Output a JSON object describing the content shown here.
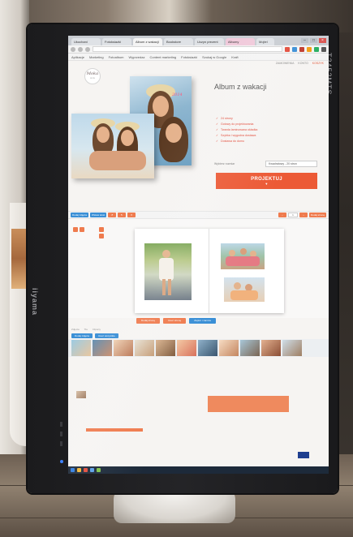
{
  "monitor": {
    "brand": "iiyama",
    "model": "T2452MTS"
  },
  "browser": {
    "tabs": [
      "Ukochani",
      "Fotoksiazki",
      "Album z wakacji",
      "Bookstore",
      "Uczyn prezent",
      "Albumy",
      "Mojtel"
    ],
    "url": "",
    "bookmarks": [
      "Aplikacje",
      "Marketing",
      "Fotoalbum",
      "Wyprzedaz",
      "Content marketing",
      "Fotoksiazki",
      "Szukaj w Google",
      "Kraft"
    ],
    "window_controls": [
      "–",
      "□",
      "×"
    ]
  },
  "site": {
    "logo_main": "Moka",
    "logo_sub": "wow",
    "top_links": [
      "ZAMOWIENIA",
      "KONTO",
      "KOSZYK"
    ],
    "cover_label": "2014"
  },
  "product": {
    "title": "Album z wakacji",
    "description": "",
    "features": [
      {
        "bullet": "✓",
        "text": "24 strony"
      },
      {
        "bullet": "✓",
        "text": "Gotowy do projektowania"
      },
      {
        "bullet": "✓",
        "text": "Twarda laminowana okładka"
      },
      {
        "bullet": "✓",
        "text": "Szybka i wygodna dostawa"
      },
      {
        "bullet": "✓",
        "text": "Dostawa do domu"
      }
    ],
    "pages_label": "Wybierz rozmiar",
    "pages_value": "Kwadratowy - 20 stron",
    "design_button": "PROJEKTUJ",
    "design_arrow": "▼"
  },
  "editor": {
    "toolbar_left": [
      "Dodaj zdjęcia",
      "Wstaw tekst"
    ],
    "toolbar_icons": [
      "↺",
      "↻",
      "✕"
    ],
    "page_value": "1",
    "toolbar_right": [
      "‹",
      "›",
      "Dodaj stronę"
    ],
    "label": "",
    "buttons": [
      "Dodaj stronę",
      "Usuń stronę",
      "Zapisz i zamów"
    ]
  },
  "strip": {
    "tabs": [
      "Zdjęcia",
      "Tła",
      "Cliparty"
    ],
    "controls": [
      "Dodaj zdjęcia",
      "Usuń wszystkie"
    ]
  },
  "summary": {
    "title": "",
    "item_text": "",
    "price": "",
    "price_note": "",
    "link": ""
  },
  "footer": {
    "logos": [
      "",
      "",
      "",
      ""
    ]
  },
  "taskbar": {
    "time": ""
  }
}
